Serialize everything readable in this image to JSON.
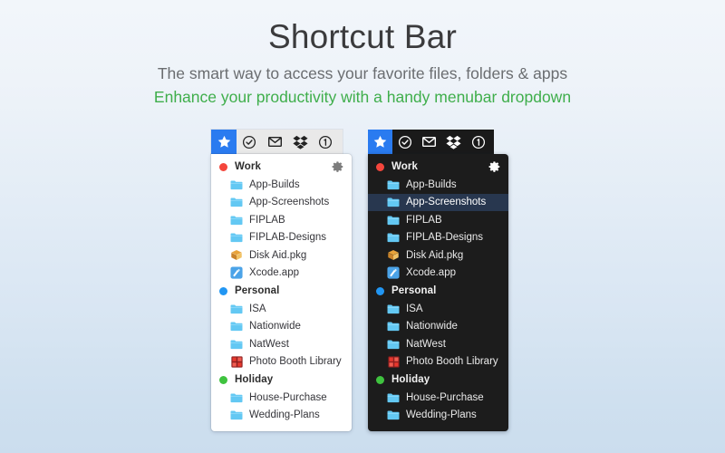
{
  "header": {
    "title": "Shortcut Bar",
    "tagline_1": "The smart way to access your favorite files, folders & apps",
    "tagline_2": "Enhance your productivity with a handy menubar dropdown",
    "title_color": "#3b3b3d",
    "tagline_1_color": "#6a6d70",
    "tagline_2_color": "#3fae4b"
  },
  "menubar": {
    "icons": [
      {
        "name": "star-icon",
        "active": true
      },
      {
        "name": "check-circle-icon",
        "active": false
      },
      {
        "name": "envelope-icon",
        "active": false
      },
      {
        "name": "dropbox-icon",
        "active": false
      },
      {
        "name": "one-circle-icon",
        "active": false
      }
    ],
    "active_color": "#2a7bf0"
  },
  "dropdown": {
    "gear_label": "settings",
    "groups": [
      {
        "label": "Work",
        "dot_color": "#f4463c",
        "items": [
          {
            "label": "App-Builds",
            "icon": "folder-icon"
          },
          {
            "label": "App-Screenshots",
            "icon": "folder-icon"
          },
          {
            "label": "FIPLAB",
            "icon": "folder-icon"
          },
          {
            "label": "FIPLAB-Designs",
            "icon": "folder-icon"
          },
          {
            "label": "Disk Aid.pkg",
            "icon": "package-icon"
          },
          {
            "label": "Xcode.app",
            "icon": "xcode-icon"
          }
        ]
      },
      {
        "label": "Personal",
        "dot_color": "#2196f3",
        "items": [
          {
            "label": "ISA",
            "icon": "folder-icon"
          },
          {
            "label": "Nationwide",
            "icon": "folder-icon"
          },
          {
            "label": "NatWest",
            "icon": "folder-icon"
          },
          {
            "label": "Photo Booth Library",
            "icon": "photobooth-icon"
          }
        ]
      },
      {
        "label": "Holiday",
        "dot_color": "#3fc33f",
        "items": [
          {
            "label": "House-Purchase",
            "icon": "folder-icon"
          },
          {
            "label": "Wedding-Plans",
            "icon": "folder-icon"
          }
        ]
      }
    ]
  },
  "panels": {
    "light": {
      "theme": "light",
      "selected_item": null
    },
    "dark": {
      "theme": "dark",
      "selected_item": "App-Screenshots"
    }
  }
}
